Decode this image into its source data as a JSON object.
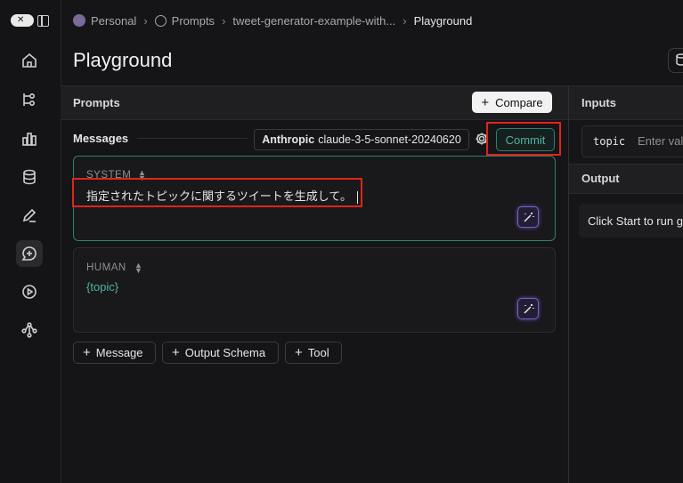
{
  "breadcrumb": {
    "workspace": "Personal",
    "section": "Prompts",
    "prompt_name": "tweet-generator-example-with...",
    "current": "Playground"
  },
  "page": {
    "title": "Playground"
  },
  "prompts_panel": {
    "title": "Prompts",
    "compare_label": "Compare",
    "messages_label": "Messages",
    "model_provider": "Anthropic",
    "model_name": "claude-3-5-sonnet-20240620",
    "commit_label": "Commit"
  },
  "messages": [
    {
      "role": "SYSTEM",
      "content": "指定されたトピックに関するツイートを生成して。"
    },
    {
      "role": "HUMAN",
      "content": "{topic}"
    }
  ],
  "add_buttons": {
    "message": "Message",
    "output_schema": "Output Schema",
    "tool": "Tool"
  },
  "inputs_panel": {
    "title": "Inputs",
    "variable": "topic",
    "placeholder": "Enter val"
  },
  "output_panel": {
    "title": "Output",
    "hint": "Click Start to run g"
  },
  "colors": {
    "accent": "#4fb3a2",
    "highlight": "#e0241b",
    "wand": "#7a5fc8"
  },
  "icons": [
    "home-icon",
    "projects-icon",
    "charts-icon",
    "datasets-icon",
    "annotation-icon",
    "prompts-icon",
    "play-icon",
    "graph-icon",
    "sidebar-toggle-icon",
    "gear-icon",
    "wand-icon",
    "database-icon"
  ]
}
